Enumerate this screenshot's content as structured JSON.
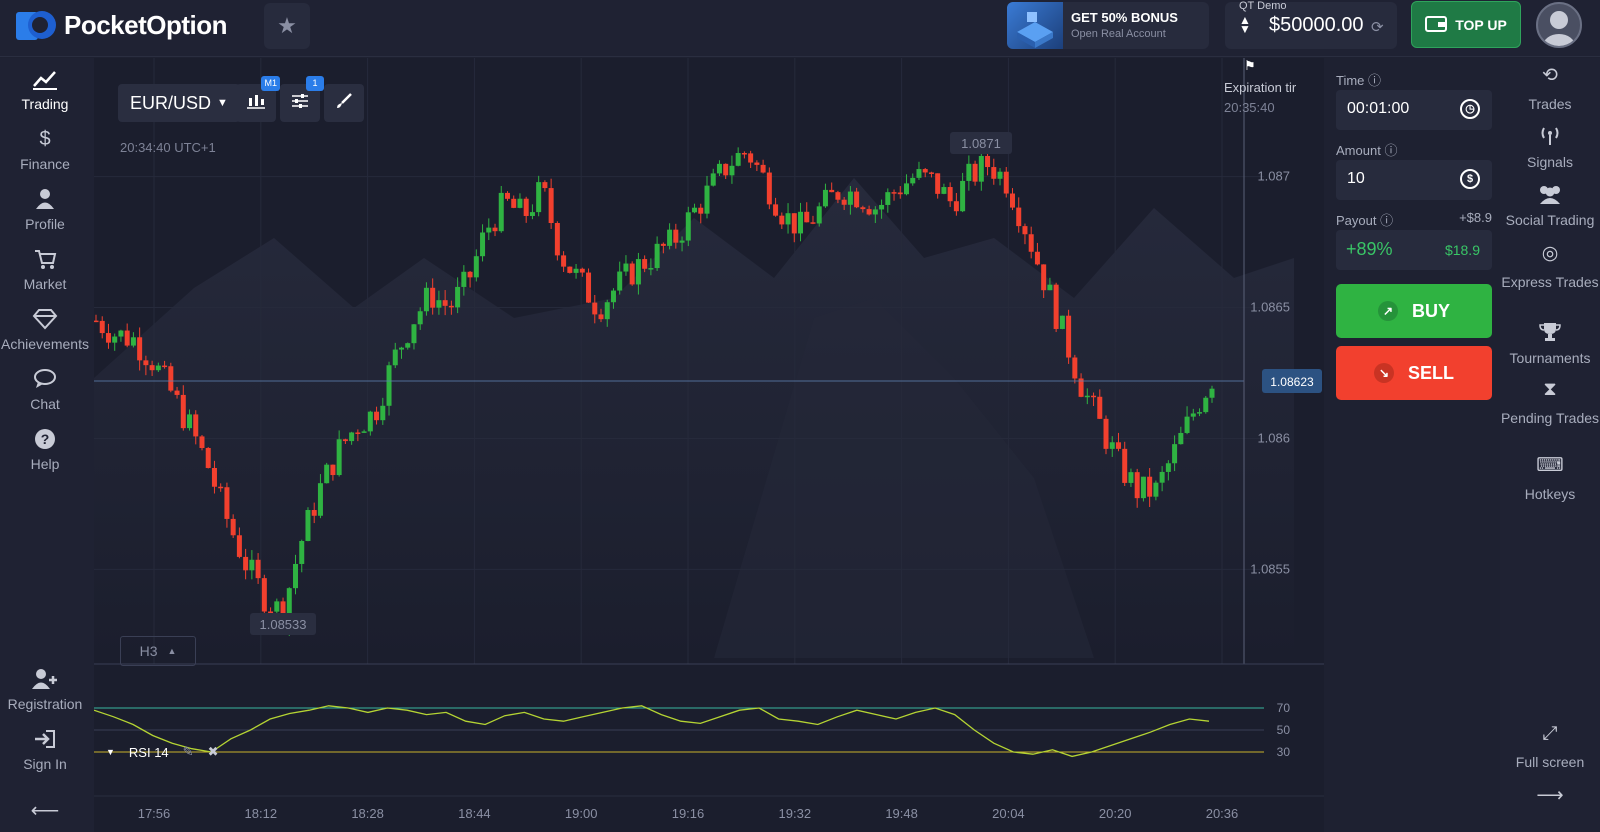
{
  "header": {
    "brand": "PocketOption",
    "bonus_title": "GET 50% BONUS",
    "bonus_subtitle": "Open Real Account",
    "account_label": "QT Demo",
    "balance": "$50000.00",
    "topup_label": "TOP UP"
  },
  "leftnav": {
    "items": [
      {
        "label": "Trading",
        "icon": "chart-line-icon"
      },
      {
        "label": "Finance",
        "icon": "dollar-icon"
      },
      {
        "label": "Profile",
        "icon": "user-icon"
      },
      {
        "label": "Market",
        "icon": "cart-icon"
      },
      {
        "label": "Achievements",
        "icon": "diamond-icon"
      },
      {
        "label": "Chat",
        "icon": "chat-icon"
      },
      {
        "label": "Help",
        "icon": "help-icon"
      }
    ],
    "bottom": [
      {
        "label": "Registration",
        "icon": "user-plus-icon"
      },
      {
        "label": "Sign In",
        "icon": "sign-in-icon"
      }
    ]
  },
  "chart_toolbar": {
    "pair": "EUR/USD",
    "chart_type_badge": "M1",
    "indicators_badge": "1"
  },
  "chart_info": {
    "server_time": "20:34:40 UTC+1",
    "timeframe": "H3",
    "expiration_label": "Expiration tir",
    "expiration_time": "20:35:40",
    "rsi_label": "RSI 14"
  },
  "chart_data": {
    "type": "candlestick",
    "symbol": "EUR/USD",
    "current_price": "1.08623",
    "high_label": "1.0871",
    "low_label": "1.08533",
    "y_ticks": [
      "1.087",
      "1.0865",
      "1.086",
      "1.0855"
    ],
    "x_ticks": [
      "17:56",
      "18:12",
      "18:28",
      "18:44",
      "19:00",
      "19:16",
      "19:32",
      "19:48",
      "20:04",
      "20:20",
      "20:36"
    ],
    "close_path": [
      1.08645,
      1.0864,
      1.08638,
      1.0863,
      1.08618,
      1.08605,
      1.0859,
      1.0857,
      1.08553,
      1.0854,
      1.08533,
      1.0856,
      1.0858,
      1.08595,
      1.08605,
      1.0861,
      1.0863,
      1.08645,
      1.08655,
      1.0865,
      1.0866,
      1.0868,
      1.0869,
      1.08685,
      1.08695,
      1.0867,
      1.0866,
      1.0865,
      1.08658,
      1.08665,
      1.0867,
      1.08675,
      1.08685,
      1.08695,
      1.08705,
      1.0871,
      1.08698,
      1.08685,
      1.0868,
      1.08688,
      1.08695,
      1.08693,
      1.08688,
      1.08695,
      1.087,
      1.08698,
      1.0869,
      1.087,
      1.08705,
      1.08698,
      1.0868,
      1.0866,
      1.0864,
      1.0862,
      1.08605,
      1.0859,
      1.0858,
      1.0858,
      1.08595,
      1.0861,
      1.08623
    ],
    "rsi": {
      "levels": [
        70,
        50,
        30
      ],
      "values": [
        68,
        62,
        55,
        45,
        38,
        33,
        30,
        42,
        50,
        60,
        65,
        68,
        72,
        70,
        66,
        70,
        68,
        64,
        66,
        58,
        55,
        63,
        66,
        60,
        58,
        62,
        66,
        70,
        72,
        64,
        58,
        56,
        62,
        68,
        70,
        60,
        58,
        55,
        62,
        68,
        64,
        60,
        66,
        70,
        64,
        50,
        38,
        30,
        28,
        32,
        26,
        30,
        36,
        42,
        48,
        55,
        60,
        58
      ]
    }
  },
  "trade": {
    "time_label": "Time",
    "time_value": "00:01:00",
    "amount_label": "Amount",
    "amount_value": "10",
    "payout_label": "Payout",
    "payout_extra": "+$8.9",
    "payout_pct": "+89%",
    "payout_amount": "$18.9",
    "buy_label": "BUY",
    "sell_label": "SELL"
  },
  "rightnav": {
    "items": [
      {
        "label": "Trades",
        "icon": "history-icon"
      },
      {
        "label": "Signals",
        "icon": "signal-icon"
      },
      {
        "label": "Social Trading",
        "icon": "users-icon"
      },
      {
        "label": "Express Trades",
        "icon": "target-icon"
      },
      {
        "label": "Tournaments",
        "icon": "trophy-icon"
      },
      {
        "label": "Pending Trades",
        "icon": "hourglass-icon"
      },
      {
        "label": "Hotkeys",
        "icon": "keyboard-icon"
      }
    ],
    "fullscreen_label": "Full screen"
  },
  "colors": {
    "bull": "#2fb342",
    "bear": "#f2402e",
    "rsi_line": "#b5d433",
    "accent": "#2b7de9"
  }
}
